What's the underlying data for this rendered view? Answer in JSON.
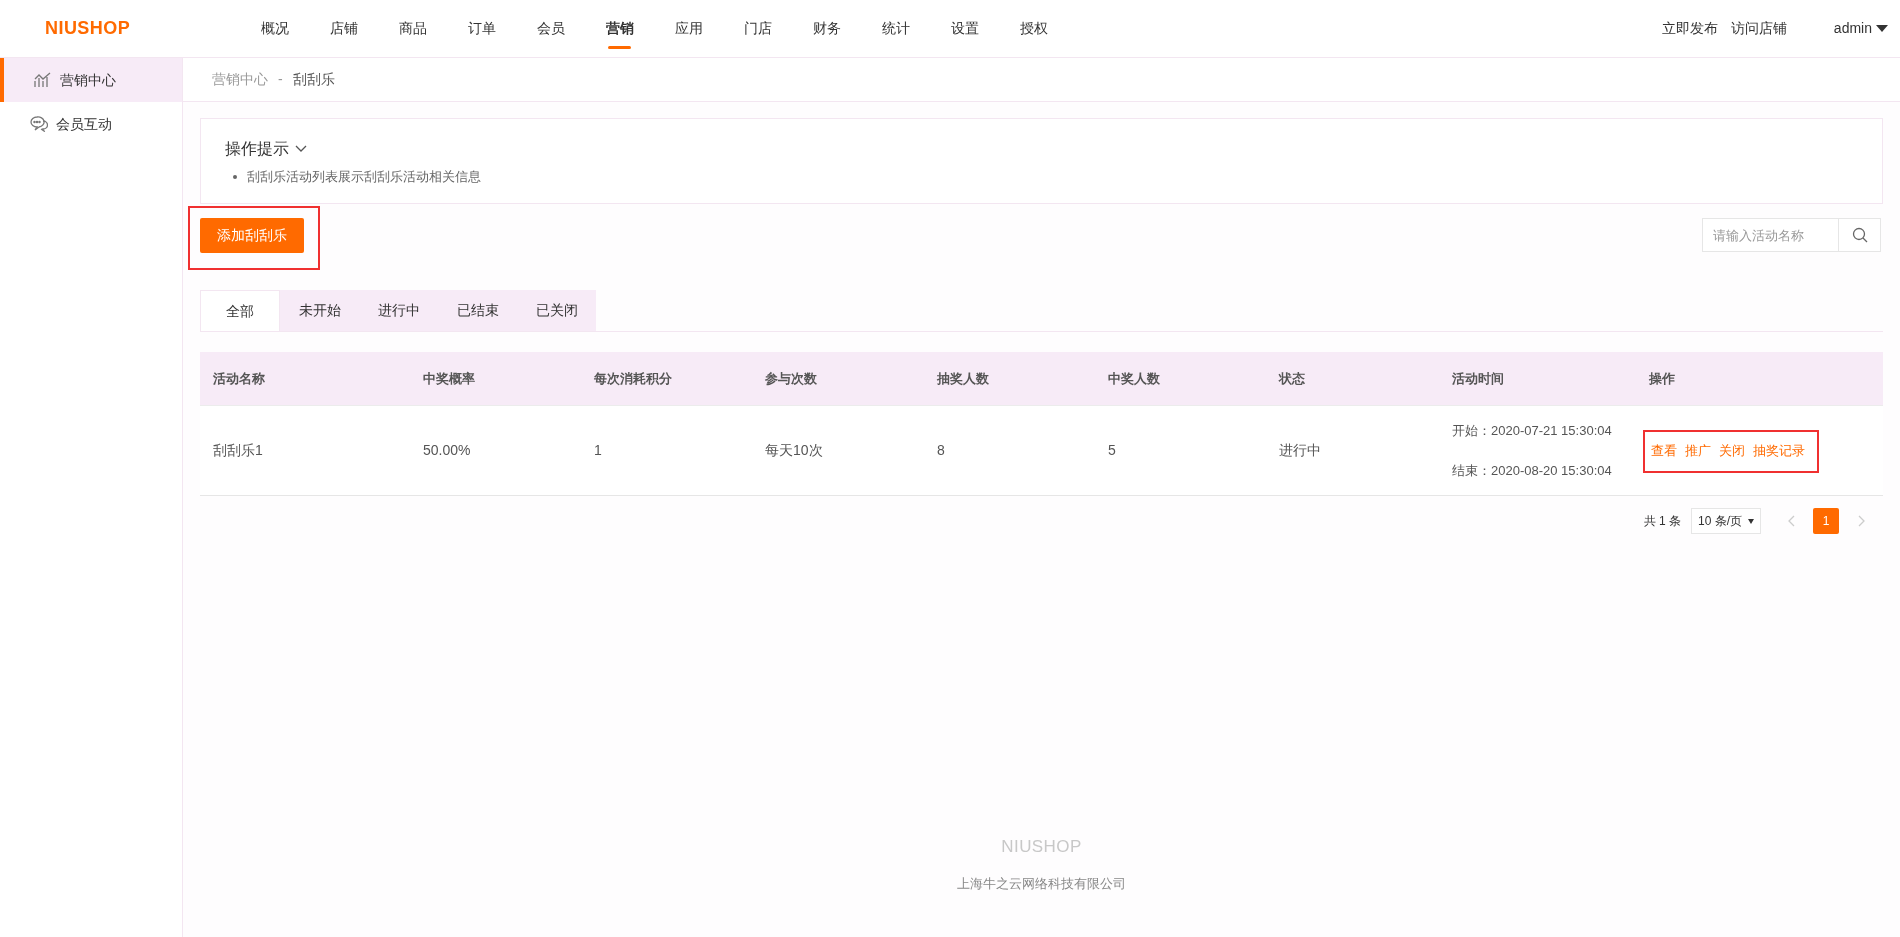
{
  "logo": "NIUSHOP",
  "nav": [
    {
      "label": "概况",
      "selected": false
    },
    {
      "label": "店铺",
      "selected": false
    },
    {
      "label": "商品",
      "selected": false
    },
    {
      "label": "订单",
      "selected": false
    },
    {
      "label": "会员",
      "selected": false
    },
    {
      "label": "营销",
      "selected": true
    },
    {
      "label": "应用",
      "selected": false
    },
    {
      "label": "门店",
      "selected": false
    },
    {
      "label": "财务",
      "selected": false
    },
    {
      "label": "统计",
      "selected": false
    },
    {
      "label": "设置",
      "selected": false
    },
    {
      "label": "授权",
      "selected": false
    }
  ],
  "header_links": [
    "立即发布",
    "访问店铺"
  ],
  "user": "admin",
  "sidebar": {
    "items": [
      {
        "label": "营销中心",
        "kind": "chart",
        "selected": true
      },
      {
        "label": "会员互动",
        "kind": "chat",
        "selected": false
      }
    ]
  },
  "breadcrumb": [
    "营销中心",
    "-",
    "刮刮乐"
  ],
  "tips": {
    "title": "操作提示",
    "expanded": true,
    "items": [
      "刮刮乐活动列表展示刮刮乐活动相关信息"
    ]
  },
  "add_button": {
    "label": "添加刮刮乐",
    "highlighted": true
  },
  "search": {
    "placeholder": "请输入活动名称"
  },
  "tabs": [
    {
      "label": "全部",
      "selected": true
    },
    {
      "label": "未开始",
      "selected": false
    },
    {
      "label": "进行中",
      "selected": false
    },
    {
      "label": "已结束",
      "selected": false
    },
    {
      "label": "已关闭",
      "selected": false
    }
  ],
  "table": {
    "columns": [
      "活动名称",
      "中奖概率",
      "每次消耗积分",
      "参与次数",
      "抽奖人数",
      "中奖人数",
      "状态",
      "活动时间",
      "操作"
    ],
    "rows": [
      {
        "cells": [
          "刮刮乐1",
          "50.00%",
          "1",
          "每天10次",
          "8",
          "5",
          "进行中"
        ],
        "time": [
          "开始：2020-07-21 15:30:04",
          "结束：2020-08-20 15:30:04"
        ],
        "actions": [
          "查看",
          "推广",
          "关闭",
          "抽奖记录"
        ],
        "actions_highlighted": true
      }
    ]
  },
  "pagination": {
    "total": "共 1 条",
    "page_size": "10 条/页",
    "pages": [
      {
        "label": "1",
        "selected": true
      }
    ]
  },
  "footer": {
    "logo": "NIUSHOP",
    "company": "上海牛之云网络科技有限公司"
  }
}
